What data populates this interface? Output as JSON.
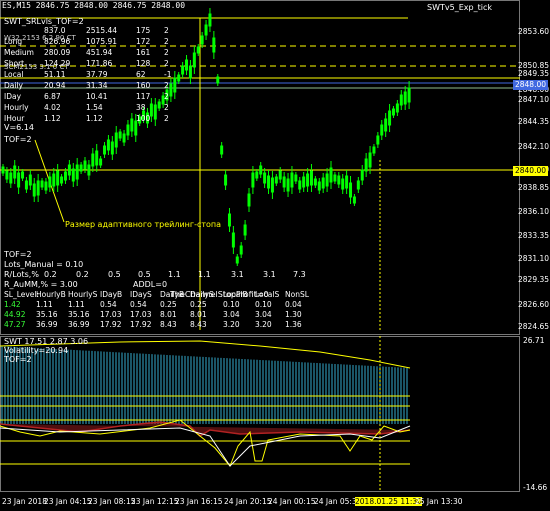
{
  "window_title": "ES,M15  2846.75 2848.00 2846.75 2848.00",
  "indicator_name": "SWTv5_Exp_tick",
  "main_info": {
    "line1": "SWT_SRLvls_TOF=2",
    "line2": "W32.2153 6.2 90 CT",
    "line3": "SCM2153 3.1 0 CT"
  },
  "level_table": [
    [
      "",
      "837.0",
      "2515.44",
      "175",
      "2"
    ],
    [
      "Long",
      "826.96",
      "1075.91",
      "172",
      "2"
    ],
    [
      "Medium",
      "280.09",
      "451.94",
      "161",
      "2"
    ],
    [
      "Short",
      "124.29",
      "171.86",
      "128",
      "2"
    ],
    [
      "Local",
      "51.11",
      "37.79",
      "62",
      "-1"
    ],
    [
      "Daily",
      "20.94",
      "31.34",
      "160",
      "2"
    ],
    [
      "IDay",
      "6.87",
      "10.41",
      "117",
      "2"
    ],
    [
      "Hourly",
      "4.02",
      "1.54",
      "38",
      "2"
    ],
    [
      "IHour",
      "1.12",
      "1.12",
      "100",
      "2"
    ]
  ],
  "v_value": "V=6.14",
  "tof_top": "TOF=2",
  "annotation": "Размер адаптивного трейлинг-стопа",
  "lower_info": {
    "tof": "TOF=2",
    "lots_manual": "Lots_Manual = 0.10",
    "r_lots_label": "R/Lots,%",
    "r_lots_values": [
      "0.2",
      "0.2",
      "0.5",
      "0.5",
      "1.1",
      "1.1",
      "3.1",
      "3.1",
      "7.3"
    ],
    "r_aumm": "R_AuMM,% = 3.00",
    "addl": "ADDL=0",
    "channel": "TheChannelStopProfit=0",
    "headers": [
      "SL_Level:",
      "HourlyB",
      "HourlyS",
      "IDayB",
      "IDayS",
      "DailyB",
      "DailyS",
      "LocalB",
      "LocalS",
      "NonSL"
    ],
    "rows": [
      [
        "1.42",
        "1.11",
        "1.11",
        "0.54",
        "0.54",
        "0.25",
        "0.25",
        "0.10",
        "0.10",
        "0.04"
      ],
      [
        "44.92",
        "35.16",
        "35.16",
        "17.03",
        "17.03",
        "8.01",
        "8.01",
        "3.04",
        "3.04",
        "1.30"
      ],
      [
        "47.27",
        "36.99",
        "36.99",
        "17.92",
        "17.92",
        "8.43",
        "8.43",
        "3.20",
        "3.20",
        "1.36"
      ]
    ]
  },
  "price_axis": [
    "2853.60",
    "2850.85",
    "2849.35",
    "2848.00",
    "2847.10",
    "2844.35",
    "2842.10",
    "2840.00",
    "2838.85",
    "2836.10",
    "2833.35",
    "2831.10",
    "2829.35",
    "2826.60",
    "2824.65"
  ],
  "price_highlights": {
    "blue_label": "2848.00",
    "yellow_label": "2840.00"
  },
  "sub_window": {
    "title": "SWT 17.51 2.87 3.06",
    "line2": "Volatility=20.94",
    "line3": "TOF=2",
    "top_value": "26.71",
    "bottom_value": "-14.66"
  },
  "time_axis": [
    "23 Jan 2018",
    "23 Jan 04:15",
    "23 Jan 08:15",
    "23 Jan 12:15",
    "23 Jan 16:15",
    "24 Jan 20:15",
    "24 Jan 00:15",
    "24 Jan 05:30",
    "2018.01.25 11:30",
    "25 Jan 13:30"
  ],
  "colors": {
    "background": "#000000",
    "candle": "#00ff00",
    "level_line": "#ffff00",
    "blue_marker": "#4169e1",
    "histogram": "#33aacc"
  }
}
